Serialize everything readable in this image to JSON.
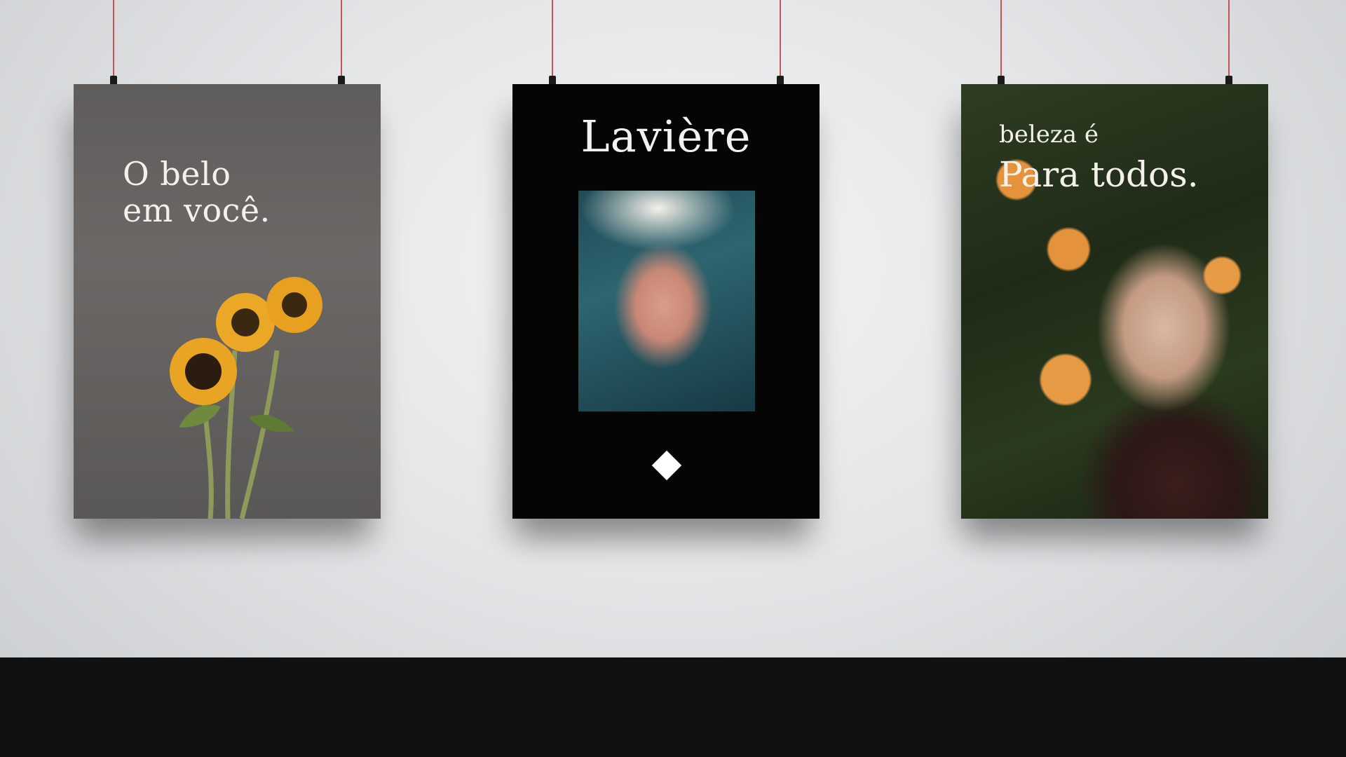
{
  "scene": {
    "wall_color": "#e3e5e7",
    "floor_band_color": "#111111",
    "wire_color": "#c63a3a"
  },
  "posters": [
    {
      "id": "sunflowers",
      "background": "#625f5d",
      "headline": "O belo\nem você.",
      "image_subject": "sunflower-bouquet"
    },
    {
      "id": "laviere",
      "background": "#050505",
      "brand": "Lavière",
      "image_subject": "woman-with-orchid-flowers",
      "emblem": "diamond-icon"
    },
    {
      "id": "beleza",
      "background": "#1f2b17",
      "line1": "beleza é",
      "line2": "Para todos.",
      "image_subject": "smiling-elderly-woman-with-orange-flowers"
    }
  ]
}
